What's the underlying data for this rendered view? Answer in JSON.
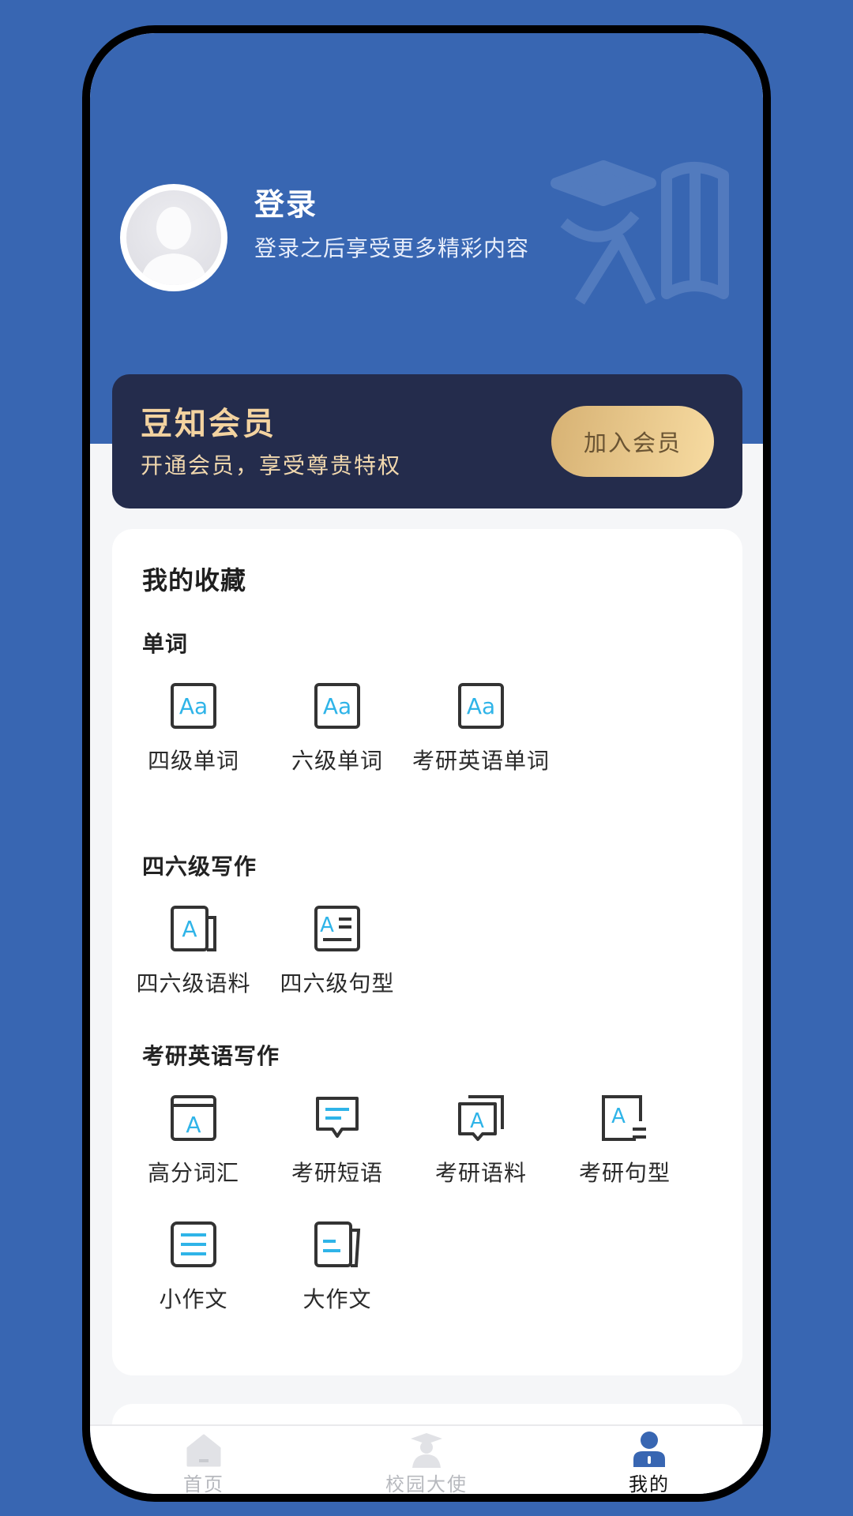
{
  "profile": {
    "title": "登录",
    "subtitle": "登录之后享受更多精彩内容"
  },
  "membership": {
    "title": "豆知会员",
    "subtitle": "开通会员，享受尊贵特权",
    "button": "加入会员"
  },
  "favorites": {
    "title": "我的收藏",
    "sections": [
      {
        "label": "单词",
        "items": [
          "四级单词",
          "六级单词",
          "考研英语单词"
        ]
      },
      {
        "label": "四六级写作",
        "items": [
          "四六级语料",
          "四六级句型"
        ]
      },
      {
        "label": "考研英语写作",
        "items": [
          "高分词汇",
          "考研短语",
          "考研语料",
          "考研句型",
          "小作文",
          "大作文"
        ]
      }
    ]
  },
  "tabs": [
    {
      "label": "首页",
      "icon": "home-icon"
    },
    {
      "label": "校园大使",
      "icon": "graduate-icon"
    },
    {
      "label": "我的",
      "icon": "user-icon",
      "active": true
    }
  ],
  "colors": {
    "primary_blue": "#3866b2",
    "member_dark": "#242c4c",
    "gold": "#f3d3a0",
    "icon_cyan": "#2fb4e8"
  }
}
